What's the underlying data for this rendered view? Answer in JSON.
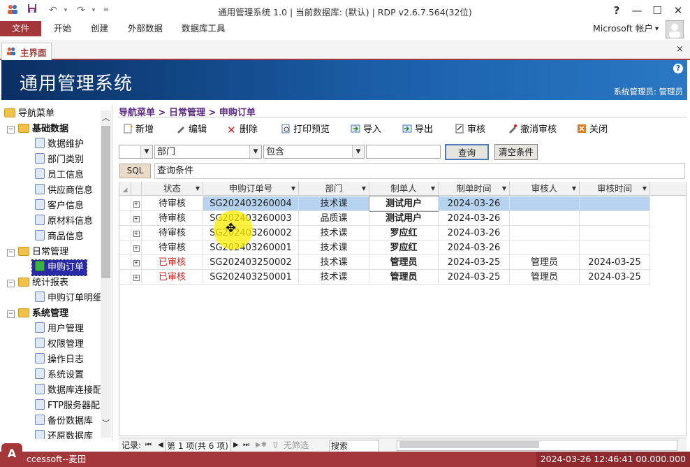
{
  "window": {
    "title": "通用管理系统 1.0 | 当前数据库: (默认) | RDP v2.6.7.564(32位)",
    "help": "?",
    "minimize": "—",
    "maximize": "☐",
    "close": "✕"
  },
  "ribbon": {
    "file_tab": "文件",
    "tabs": [
      "开始",
      "创建",
      "外部数据",
      "数据库工具"
    ],
    "account": "Microsoft 帐户",
    "account_arrow": "▾"
  },
  "doc_tab": {
    "label": "主界面",
    "close": "×"
  },
  "banner": {
    "title": "通用管理系统",
    "user": "系统管理员: 管理员",
    "help": "?"
  },
  "nav": {
    "root": "导航菜单",
    "groups": [
      {
        "label": "基础数据",
        "items": [
          "数据维护",
          "部门类别",
          "员工信息",
          "供应商信息",
          "客户信息",
          "原材料信息",
          "商品信息"
        ]
      },
      {
        "label": "日常管理",
        "items": [
          "申购订单"
        ]
      },
      {
        "label": "统计报表",
        "items": [
          "申购订单明细"
        ]
      },
      {
        "label": "系统管理",
        "items": [
          "用户管理",
          "权限管理",
          "操作日志",
          "系统设置",
          "数据库连接配置",
          "FTP服务器配置",
          "备份数据库",
          "还原数据库"
        ]
      }
    ]
  },
  "breadcrumb": "导航菜单 > 日常管理 > 申购订单",
  "toolbar": {
    "add": "新增",
    "edit": "编辑",
    "delete": "删除",
    "print_preview": "打印预览",
    "import": "导入",
    "export": "导出",
    "audit": "审核",
    "cancel_audit": "撤消审核",
    "close": "关闭"
  },
  "filter": {
    "field1": "",
    "field2": "部门",
    "operator": "包含",
    "value": "",
    "query_btn": "查询",
    "clear_btn": "清空条件",
    "sql_btn": "SQL",
    "condition": "查询条件"
  },
  "grid": {
    "headers": [
      "状态",
      "申购订单号",
      "部门",
      "制单人",
      "制单时间",
      "审核人",
      "审核时间"
    ],
    "rows": [
      {
        "status": "待审核",
        "no": "SG202403260004",
        "dept": "技术课",
        "maker": "测试用户",
        "date": "2024-03-26",
        "auditor": "",
        "audit_date": ""
      },
      {
        "status": "待审核",
        "no": "SG202403260003",
        "dept": "品质课",
        "maker": "测试用户",
        "date": "2024-03-26",
        "auditor": "",
        "audit_date": ""
      },
      {
        "status": "待审核",
        "no": "SG202403260002",
        "dept": "技术课",
        "maker": "罗应红",
        "date": "2024-03-26",
        "auditor": "",
        "audit_date": ""
      },
      {
        "status": "待审核",
        "no": "SG202403260001",
        "dept": "技术课",
        "maker": "罗应红",
        "date": "2024-03-26",
        "auditor": "",
        "audit_date": ""
      },
      {
        "status": "已审核",
        "no": "SG202403250002",
        "dept": "技术课",
        "maker": "管理员",
        "date": "2024-03-25",
        "auditor": "管理员",
        "audit_date": "2024-03-25"
      },
      {
        "status": "已审核",
        "no": "SG202403250001",
        "dept": "技术课",
        "maker": "管理员",
        "date": "2024-03-25",
        "auditor": "管理员",
        "audit_date": "2024-03-25"
      }
    ]
  },
  "record_nav": {
    "label": "记录:",
    "position": "第 1 项(共 6 项)",
    "no_filter": "无筛选",
    "search": "搜索"
  },
  "status_bar": {
    "left": "ccessoft--麦田",
    "time": "2024-03-26 12:46:41 00.000.000"
  },
  "colors": {
    "accent": "#a4373a",
    "banner": "#1b5ea8",
    "breadcrumb": "#5b2a82",
    "status_audited": "#d21f1f",
    "selected_row": "#b6d4f0"
  }
}
